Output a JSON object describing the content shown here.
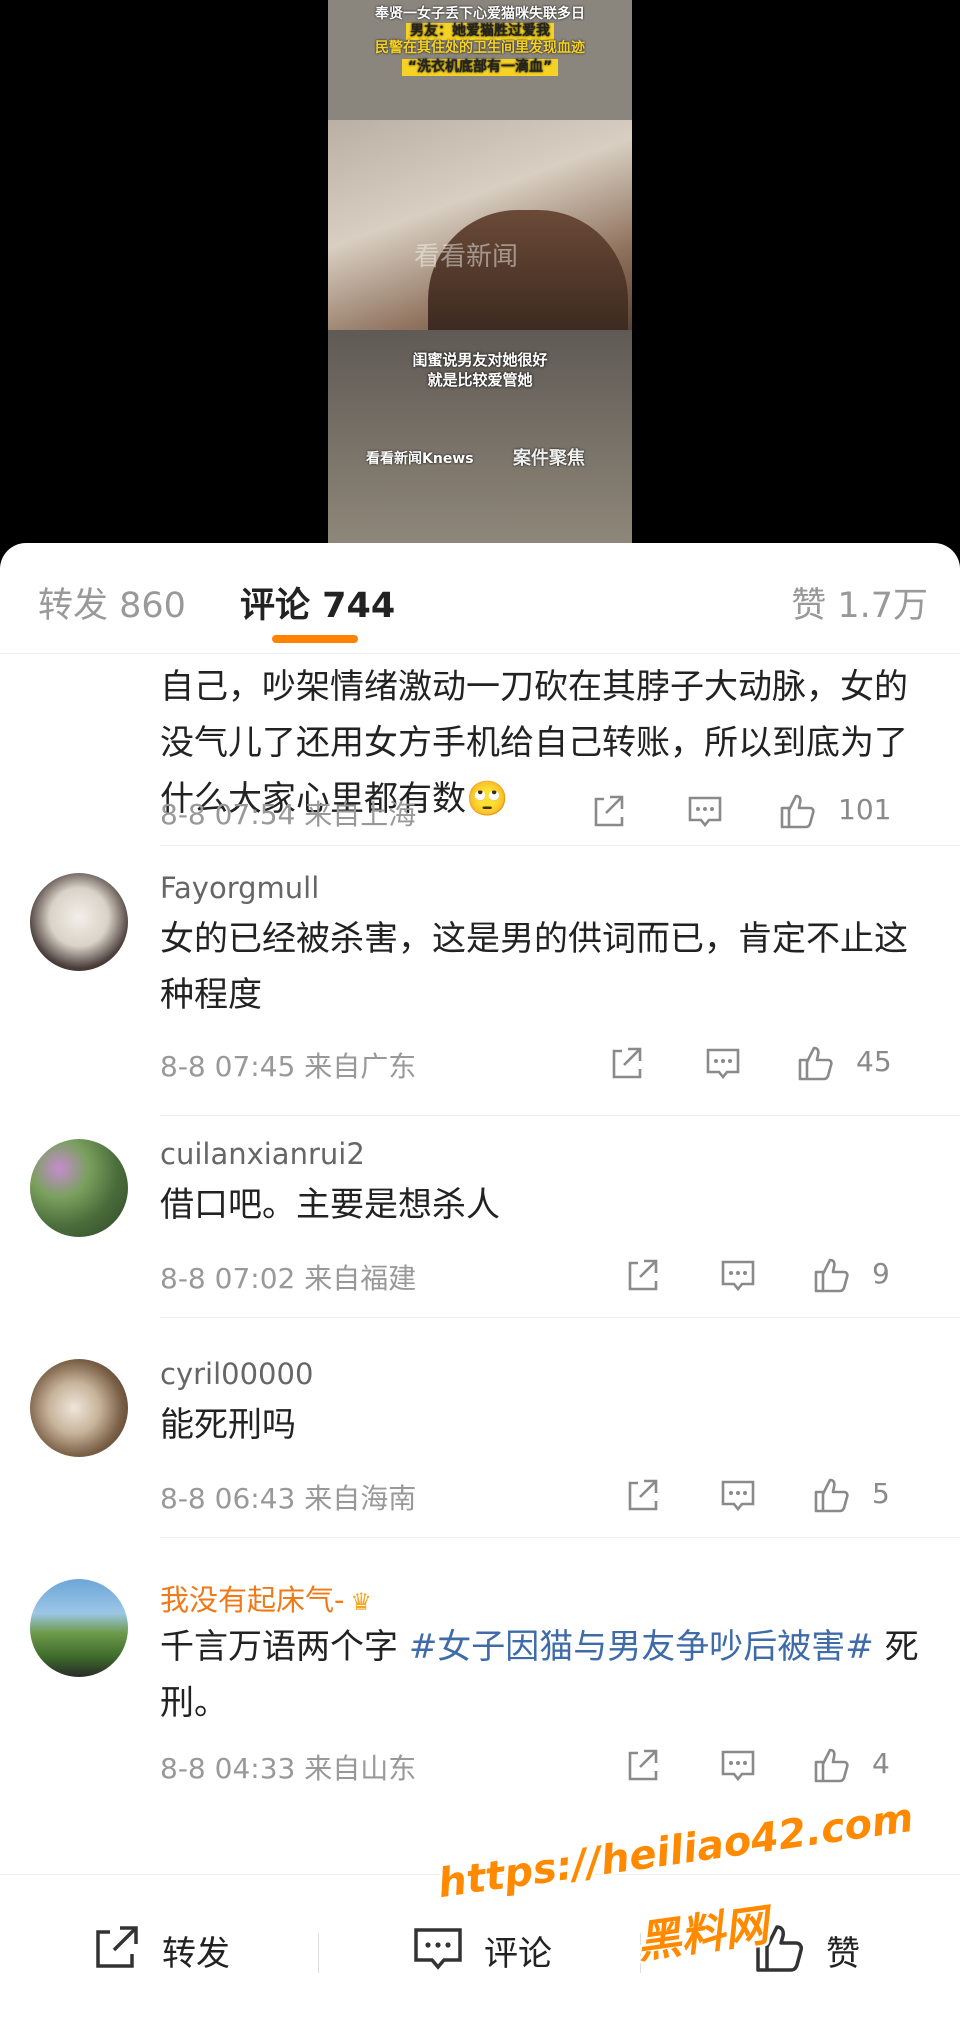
{
  "video": {
    "caption_lines": [
      "奉贤一女子丢下心爱猫咪失联多日",
      "男友：她爱猫胜过爱我",
      "民警在其住处的卫生间里发现血迹",
      "“洗衣机底部有一滴血”"
    ],
    "watermark": "看看新闻",
    "subtitle_lines": [
      "闺蜜说男友对她很好",
      "就是比较爱管她"
    ],
    "brand": "看看新闻Knews",
    "brand2": "案件聚焦"
  },
  "tabs": {
    "repost": "转发 860",
    "comments": "评论 744",
    "likes": "赞 1.7万"
  },
  "comments": [
    {
      "name": "",
      "text": "自己，吵架情绪激动一刀砍在其脖子大动脉，女的没气儿了还用女方手机给自己转账，所以到底为了什么大家心里都有数",
      "emoji": "🙄",
      "meta": "8-8 07:54  来自上海",
      "likes": "101"
    },
    {
      "name": "Fayorgmull",
      "text": "女的已经被杀害，这是男的供词而已，肯定不止这种程度",
      "meta": "8-8 07:45  来自广东",
      "likes": "45"
    },
    {
      "name": "cuilanxianrui2",
      "text": "借口吧。主要是想杀人",
      "meta": "8-8 07:02  来自福建",
      "likes": "9"
    },
    {
      "name": "cyril00000",
      "text": "能死刑吗",
      "meta": "8-8 06:43  来自海南",
      "likes": "5"
    },
    {
      "name": "我没有起床气-",
      "text_before": "千言万语两个字 ",
      "hashtag": "#女子因猫与男友争吵后被害#",
      "text_after": " 死刑。",
      "meta": "8-8 04:33  来自山东",
      "likes": "4"
    }
  ],
  "bottom_bar": {
    "repost": "转发",
    "comment": "评论",
    "like": "赞"
  },
  "watermark_site": {
    "url": "https://heiliao42.com",
    "name": "黑料网"
  },
  "colors": {
    "accent": "#ff8200",
    "hashtag": "#3f6ba8",
    "vip_name": "#f07a18"
  }
}
